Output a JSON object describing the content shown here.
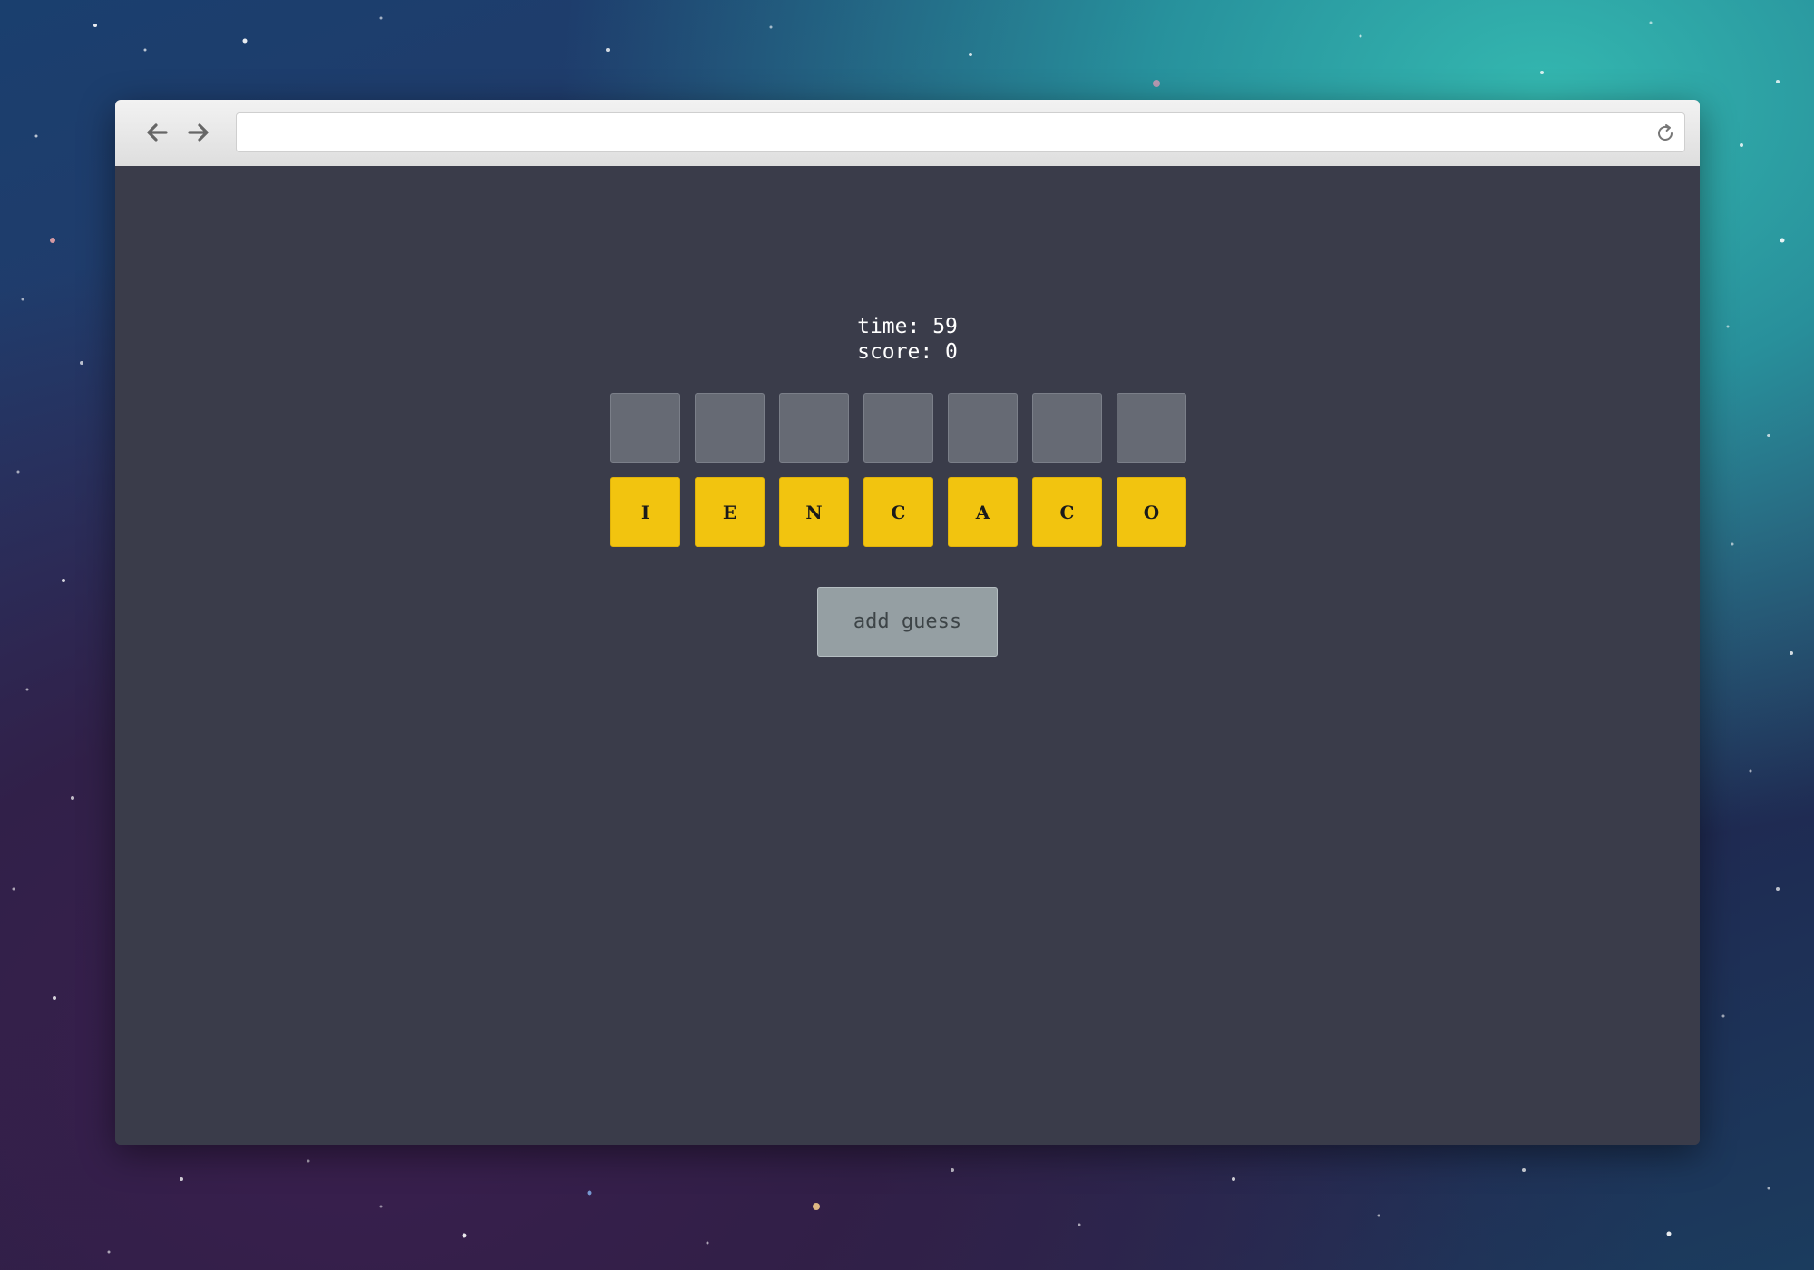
{
  "browser": {
    "url": ""
  },
  "game": {
    "time_label": "time: 59",
    "score_label": "score: 0",
    "guess_slots": [
      "",
      "",
      "",
      "",
      "",
      "",
      ""
    ],
    "letters": [
      "I",
      "E",
      "N",
      "C",
      "A",
      "C",
      "O"
    ],
    "add_guess_label": "add guess"
  },
  "colors": {
    "page_background": "#3a3c4a",
    "slot": "#666a74",
    "letter_tile": "#f2c40f",
    "button": "#959fa3"
  },
  "icons": {
    "back": "arrow-left-icon",
    "forward": "arrow-right-icon",
    "reload": "reload-icon"
  }
}
